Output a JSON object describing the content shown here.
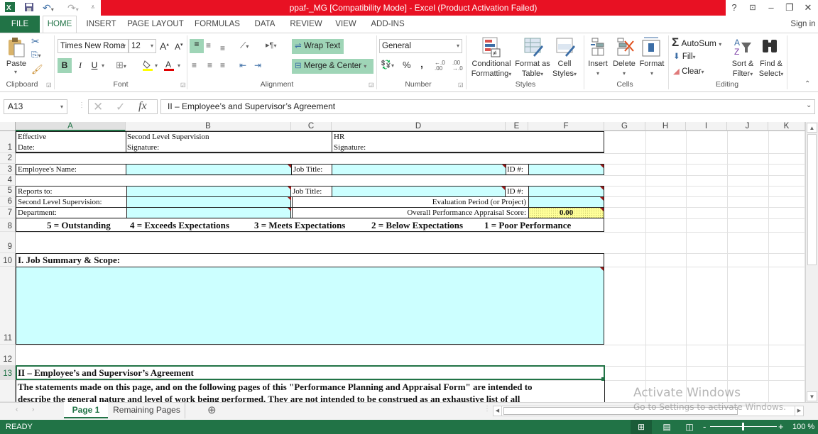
{
  "window": {
    "title": "ppaf-_MG  [Compatibility Mode] -  Excel (Product Activation Failed)",
    "controls": [
      "?",
      "ribbon-display-options",
      "minimize",
      "restore",
      "close"
    ],
    "sign_in": "Sign in"
  },
  "quick_access": [
    "excel-logo",
    "save",
    "undo",
    "redo",
    "customize"
  ],
  "ribbon_tabs": [
    "FILE",
    "HOME",
    "INSERT",
    "PAGE LAYOUT",
    "FORMULAS",
    "DATA",
    "REVIEW",
    "VIEW",
    "ADD-INS"
  ],
  "active_tab": "HOME",
  "ribbon": {
    "clipboard": {
      "label": "Clipboard",
      "paste": "Paste"
    },
    "font": {
      "label": "Font",
      "font_name": "Times New Roma",
      "font_size": "12",
      "bold": "B",
      "italic": "I",
      "underline": "U"
    },
    "alignment": {
      "label": "Alignment",
      "wrap_text": "Wrap Text",
      "merge_center": "Merge & Center"
    },
    "number": {
      "label": "Number",
      "format": "General",
      "percent": "%",
      "comma": ","
    },
    "styles": {
      "label": "Styles",
      "conditional_1": "Conditional",
      "conditional_2": "Formatting",
      "format_table_1": "Format as",
      "format_table_2": "Table",
      "cell_styles_1": "Cell",
      "cell_styles_2": "Styles"
    },
    "cells": {
      "label": "Cells",
      "insert": "Insert",
      "delete": "Delete",
      "format": "Format"
    },
    "editing": {
      "label": "Editing",
      "autosum": "AutoSum",
      "fill": "Fill",
      "clear": "Clear",
      "sort_1": "Sort &",
      "sort_2": "Filter",
      "find_1": "Find &",
      "find_2": "Select"
    }
  },
  "formula_bar": {
    "name_box": "A13",
    "formula": "II – Employee’s and Supervisor’s Agreement"
  },
  "columns": [
    "A",
    "B",
    "C",
    "D",
    "E",
    "F",
    "G",
    "H",
    "I",
    "J",
    "K"
  ],
  "rows": [
    "1",
    "2",
    "3",
    "4",
    "5",
    "6",
    "7",
    "8",
    "9",
    "10",
    "11",
    "12",
    "13"
  ],
  "sheet": {
    "r1": {
      "a1": "Effective",
      "a2": "Date:",
      "b1": "Second Level Supervision",
      "b2": "Signature:",
      "d1": "HR",
      "d2": "Signature:"
    },
    "r3": {
      "a": "Employee's Name:",
      "c": "Job Title:",
      "e": "ID #:"
    },
    "r5": {
      "a": "Reports to:",
      "c": "Job Title:",
      "e": "ID #:"
    },
    "r6": {
      "a": "Second Level Supervision:",
      "label": "Evaluation Period (or Project)"
    },
    "r7": {
      "a": "Department:",
      "label": "Overall Performance Appraisal Score:",
      "score": "0.00"
    },
    "r8": {
      "scale": [
        "5 = Outstanding",
        "4 = Exceeds Expectations",
        "3 = Meets Expectations",
        "2 = Below Expectations",
        "1 = Poor Performance"
      ]
    },
    "r10": {
      "a": "I. Job Summary & Scope:"
    },
    "r13": {
      "a": "II – Employee’s and Supervisor’s Agreement"
    },
    "r14": {
      "line1": "The statements made on this page, and on the following pages of this \"Performance Planning and Appraisal Form\" are intended to",
      "line2": "describe the general nature and level of work being performed. They are not intended to be construed as an exhaustive list of all"
    }
  },
  "sheet_tabs": [
    "Page 1",
    "Remaining Pages"
  ],
  "active_sheet": "Page 1",
  "status": {
    "mode": "READY",
    "zoom": "100 %"
  },
  "watermark": {
    "line1": "Activate Windows",
    "line2": "Go to Settings to activate Windows."
  },
  "colors": {
    "excel_green": "#217346",
    "title_red": "#e81123",
    "input_cyan": "#ccffff",
    "score_yellow": "#ffff99"
  }
}
